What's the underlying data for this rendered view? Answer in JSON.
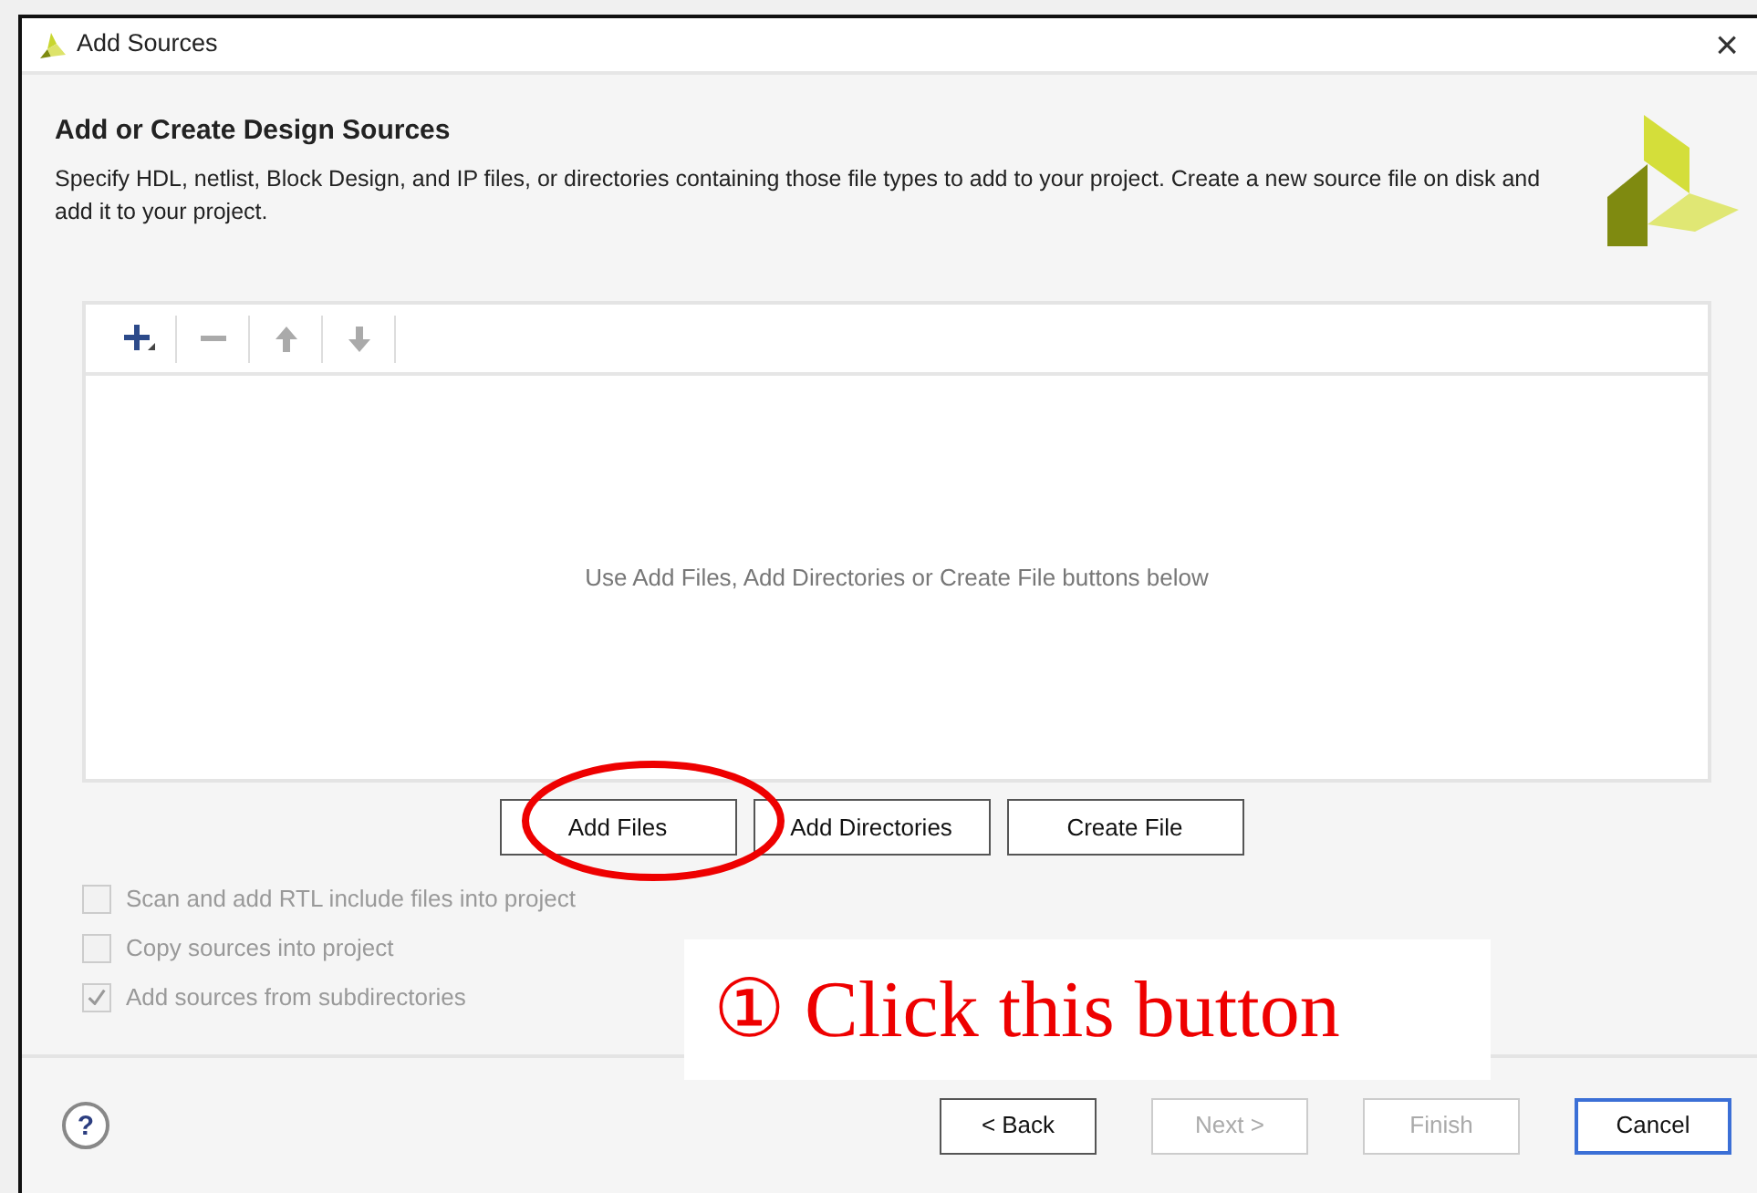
{
  "window": {
    "title": "Add Sources",
    "close": "×"
  },
  "header": {
    "title": "Add or Create Design Sources",
    "description": "Specify HDL, netlist, Block Design, and IP files, or directories containing those file types to add to your project. Create a new source file on disk and add it to your project."
  },
  "toolbar": [
    {
      "kind": "add",
      "disabled": false
    },
    {
      "kind": "remove",
      "disabled": true
    },
    {
      "kind": "up",
      "disabled": true
    },
    {
      "kind": "down",
      "disabled": true
    }
  ],
  "file_list": {
    "empty_message": "Use Add Files, Add Directories or Create File buttons below"
  },
  "action_buttons": [
    {
      "label": "Add Files",
      "highlighted": true
    },
    {
      "label": "Add Directories",
      "highlighted": false
    },
    {
      "label": "Create File",
      "highlighted": false
    }
  ],
  "options": [
    {
      "label": "Scan and add RTL include files into project",
      "checked": false,
      "disabled": true
    },
    {
      "label": "Copy sources into project",
      "checked": false,
      "disabled": true
    },
    {
      "label": "Add sources from subdirectories",
      "checked": true,
      "disabled": true
    }
  ],
  "annotation": {
    "text": "① Click this button"
  },
  "help": "?",
  "footer_buttons": [
    {
      "label": "< Back",
      "disabled": false,
      "default": false
    },
    {
      "label": "Next >",
      "disabled": true,
      "default": false
    },
    {
      "label": "Finish",
      "disabled": true,
      "default": false
    },
    {
      "label": "Cancel",
      "disabled": false,
      "default": true
    }
  ]
}
